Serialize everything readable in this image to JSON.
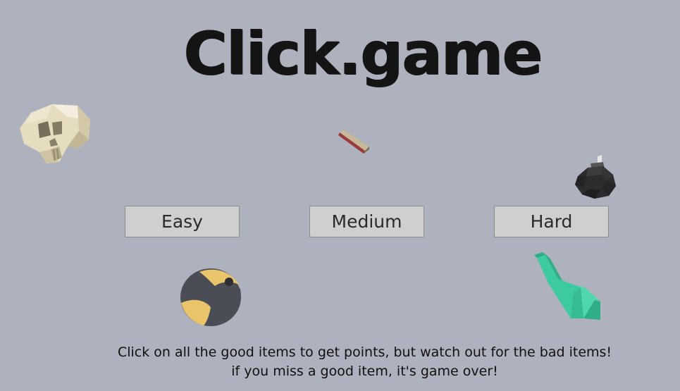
{
  "title": "Click.game",
  "buttons": {
    "easy": "Easy",
    "medium": "Medium",
    "hard": "Hard"
  },
  "instructions": {
    "line1": "Click on all the good items to get points, but watch out for the bad items!",
    "line2": "if you miss a good item, it's game over!"
  },
  "items": [
    {
      "name": "skull-icon",
      "kind": "bad"
    },
    {
      "name": "plank-icon",
      "kind": "good"
    },
    {
      "name": "bomb-icon",
      "kind": "bad"
    },
    {
      "name": "ball-icon",
      "kind": "good"
    },
    {
      "name": "bottle-icon",
      "kind": "good"
    }
  ],
  "colors": {
    "background": "#aeb1be",
    "button_bg": "#cfcfcf",
    "text": "#141414",
    "skull": "#e6dcc0",
    "ball_yellow": "#e9c46a",
    "ball_dark": "#4a4d55",
    "bottle": "#3ecaa0",
    "bomb": "#2c2c2e"
  }
}
